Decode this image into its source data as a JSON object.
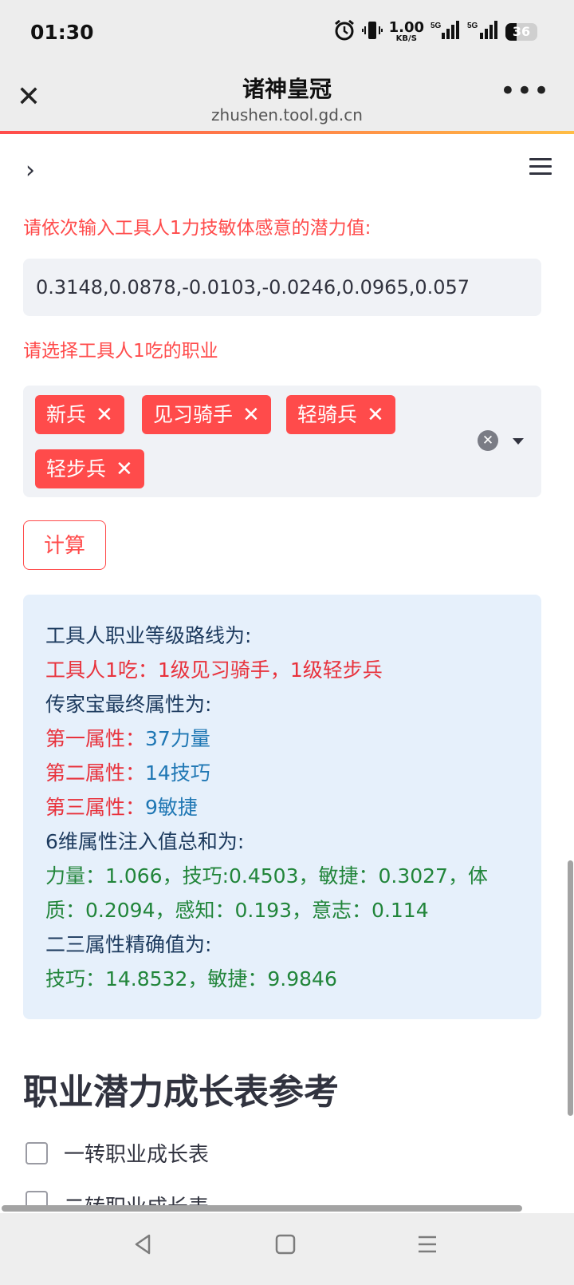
{
  "status": {
    "time": "01:30",
    "net_speed": "1.00",
    "net_unit": "KB/S",
    "sig1": "5G",
    "sig2": "5G",
    "battery": "36",
    "battery_level": 0.36
  },
  "header": {
    "title": "诸神皇冠",
    "url": "zhushen.tool.gd.cn"
  },
  "form": {
    "potential_label": "请依次输入工具人1力技敏体感意的潜力值:",
    "potential_value": "0.3148,0.0878,-0.0103,-0.0246,0.0965,0.057",
    "job_label": "请选择工具人1吃的职业",
    "jobs": [
      "新兵",
      "见习骑手",
      "轻骑兵",
      "轻步兵"
    ],
    "calc_button": "计算"
  },
  "result": {
    "route_title": "工具人职业等级路线为:",
    "route": "工具人1吃：1级见习骑手，1级轻步兵",
    "final_title": "传家宝最终属性为:",
    "attrs": [
      {
        "label": "第一属性：",
        "value": "37力量"
      },
      {
        "label": "第二属性：",
        "value": "14技巧"
      },
      {
        "label": "第三属性：",
        "value": "9敏捷"
      }
    ],
    "sum_title": "6维属性注入值总和为:",
    "sum_value": "力量：1.066，技巧:0.4503，敏捷：0.3027，体质：0.2094，感知：0.193，意志：0.114",
    "exact_title": "二三属性精确值为:",
    "exact_value": "技巧：14.8532，敏捷：9.9846"
  },
  "section": {
    "title": "职业潜力成长表参考",
    "checkboxes": [
      "一转职业成长表",
      "二转职业成长表"
    ]
  },
  "colors": {
    "accent": "#ff4b4b",
    "info_bg": "#e6f0fb",
    "input_bg": "#f0f2f6"
  }
}
